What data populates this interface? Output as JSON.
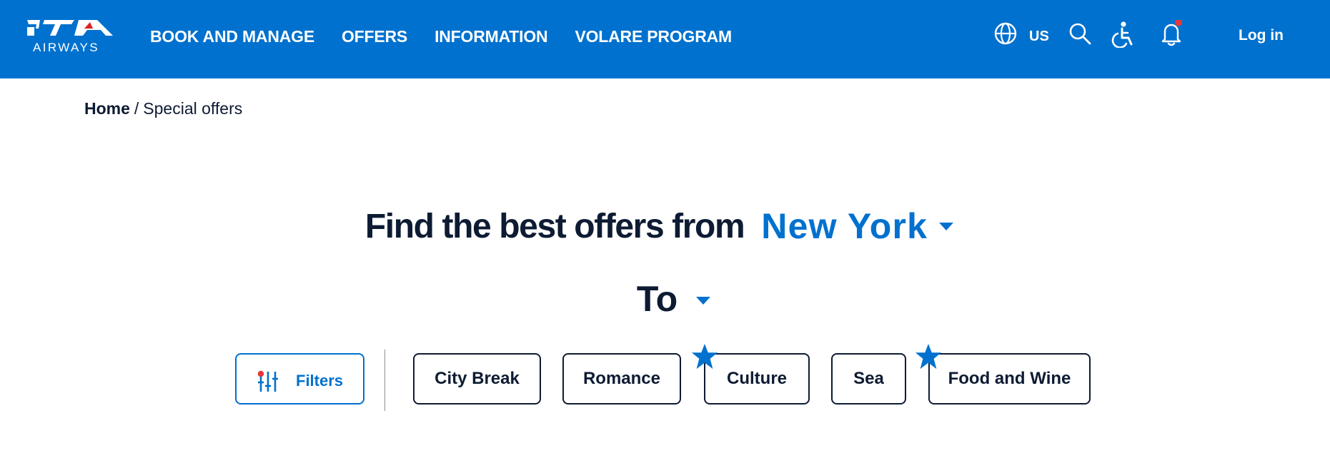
{
  "header": {
    "logo_text": "ITA",
    "logo_word": "AIRWAYS",
    "nav": [
      {
        "label": "BOOK AND MANAGE"
      },
      {
        "label": "OFFERS"
      },
      {
        "label": "INFORMATION"
      },
      {
        "label": "VOLARE PROGRAM"
      }
    ],
    "language": "US",
    "login_label": "Log in",
    "notification_dot_color": "#e53935",
    "brand_color": "#0071ce"
  },
  "breadcrumb": {
    "home": "Home",
    "separator": "/",
    "current": "Special offers"
  },
  "search": {
    "heading_prefix": "Find the best offers from",
    "origin_city": "New York",
    "to_label": "To"
  },
  "filters": {
    "button_label": "Filters",
    "categories": [
      {
        "label": "City Break",
        "starred": false
      },
      {
        "label": "Romance",
        "starred": false
      },
      {
        "label": "Culture",
        "starred": true
      },
      {
        "label": "Sea",
        "starred": false
      },
      {
        "label": "Food and Wine",
        "starred": true
      }
    ]
  },
  "icons": {
    "logo": "ita-airways-logo",
    "language": "globe-icon",
    "search": "search-icon",
    "accessibility": "accessibility-icon",
    "notifications": "bell-icon",
    "dropdown": "caret-down-icon",
    "filters": "sliders-icon",
    "featured": "star-icon"
  }
}
